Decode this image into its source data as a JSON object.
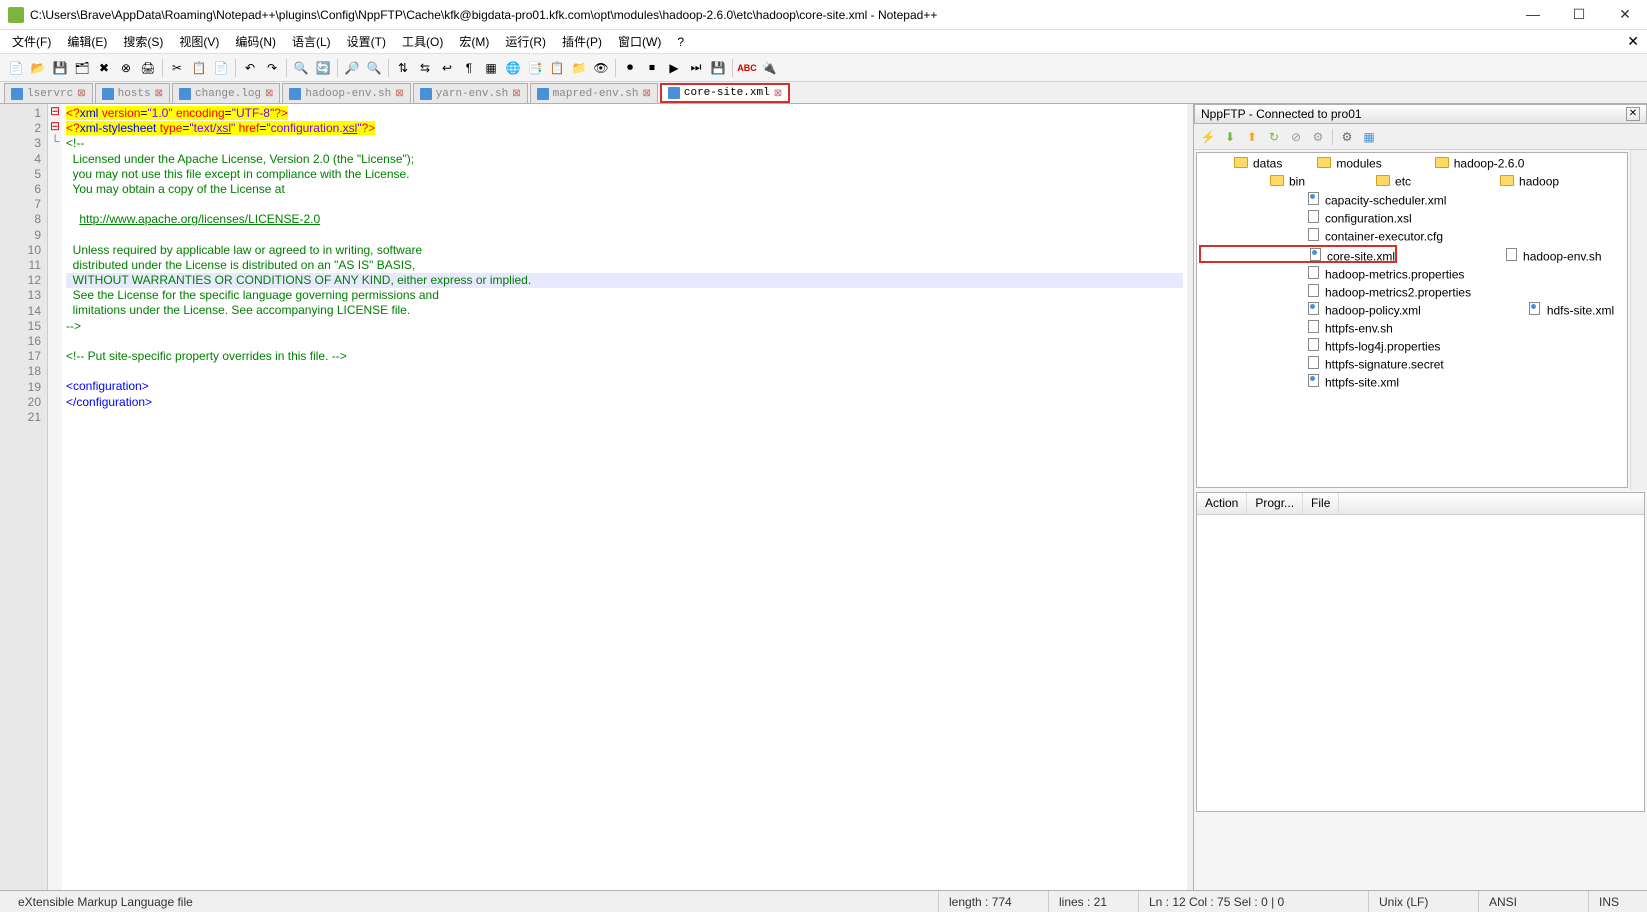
{
  "window": {
    "title": "C:\\Users\\Brave\\AppData\\Roaming\\Notepad++\\plugins\\Config\\NppFTP\\Cache\\kfk@bigdata-pro01.kfk.com\\opt\\modules\\hadoop-2.6.0\\etc\\hadoop\\core-site.xml - Notepad++"
  },
  "menu": {
    "items": [
      "文件(F)",
      "编辑(E)",
      "搜索(S)",
      "视图(V)",
      "编码(N)",
      "语言(L)",
      "设置(T)",
      "工具(O)",
      "宏(M)",
      "运行(R)",
      "插件(P)",
      "窗口(W)",
      "?"
    ]
  },
  "tabs": [
    {
      "label": "lservrc",
      "active": false
    },
    {
      "label": "hosts",
      "active": false
    },
    {
      "label": "change.log",
      "active": false
    },
    {
      "label": "hadoop-env.sh",
      "active": false
    },
    {
      "label": "yarn-env.sh",
      "active": false
    },
    {
      "label": "mapred-env.sh",
      "active": false
    },
    {
      "label": "core-site.xml",
      "active": true,
      "highlighted": true
    }
  ],
  "code": {
    "lines": [
      {
        "n": 1,
        "html": "<span class='hl-yellow'><span class='c-red'>&lt;?</span><span class='c-blue'>xml</span> <span class='c-red'>version</span>=<span class='c-purple'>\"1.0\"</span> <span class='c-red'>encoding</span>=<span class='c-purple'>\"UTF-8\"</span><span class='c-red'>?&gt;</span></span>"
      },
      {
        "n": 2,
        "html": "<span class='hl-yellow'><span class='c-red'>&lt;?</span><span class='c-blue'>xml-stylesheet</span> <span class='c-red'>type</span>=<span class='c-purple'>\"text/</span><span class='c-purple underline'>xsl</span><span class='c-purple'>\"</span> <span class='c-red'>href</span>=<span class='c-purple'>\"configuration.</span><span class='c-purple underline'>xsl</span><span class='c-purple'>\"</span><span class='c-red'>?&gt;</span></span>"
      },
      {
        "n": 3,
        "fold": "⊟",
        "html": "<span class='c-green'>&lt;!--</span>"
      },
      {
        "n": 4,
        "html": "<span class='c-green'>  Licensed under the Apache License, Version 2.0 (the \"License\");</span>"
      },
      {
        "n": 5,
        "html": "<span class='c-green'>  you may not use this file except in compliance with the License.</span>"
      },
      {
        "n": 6,
        "html": "<span class='c-green'>  You may obtain a copy of the License at</span>"
      },
      {
        "n": 7,
        "html": ""
      },
      {
        "n": 8,
        "html": "<span class='c-green'>    </span><span class='c-green underline'>http://www.apache.org/licenses/LICENSE-2.0</span>"
      },
      {
        "n": 9,
        "html": ""
      },
      {
        "n": 10,
        "html": "<span class='c-green'>  Unless required by applicable law or agreed to in writing, software</span>"
      },
      {
        "n": 11,
        "html": "<span class='c-green'>  distributed under the License is distributed on an \"AS IS\" BASIS,</span>"
      },
      {
        "n": 12,
        "cursor": true,
        "html": "<span class='c-green'>  WITHOUT WARRANTIES OR CONDITIONS OF ANY KIND, either express or implied.</span>"
      },
      {
        "n": 13,
        "html": "<span class='c-green'>  See the License for the specific language governing permissions and</span>"
      },
      {
        "n": 14,
        "html": "<span class='c-green'>  limitations under the License. See accompanying LICENSE file.</span>"
      },
      {
        "n": 15,
        "html": "<span class='c-green'>--&gt;</span>"
      },
      {
        "n": 16,
        "html": ""
      },
      {
        "n": 17,
        "html": "<span class='c-green'>&lt;!-- Put site-specific property overrides in this file. --&gt;</span>"
      },
      {
        "n": 18,
        "html": ""
      },
      {
        "n": 19,
        "fold": "⊟",
        "html": "<span class='c-blue'>&lt;configuration&gt;</span>"
      },
      {
        "n": 20,
        "fold": "└",
        "html": "<span class='c-blue'>&lt;/configuration&gt;</span>"
      },
      {
        "n": 21,
        "html": ""
      }
    ]
  },
  "nppftp": {
    "title": "NppFTP - Connected to pro01",
    "tree": [
      {
        "indent": 2,
        "type": "folder",
        "label": "datas"
      },
      {
        "indent": 2,
        "type": "folder",
        "label": "modules"
      },
      {
        "indent": 3,
        "type": "folder",
        "label": "hadoop-2.6.0"
      },
      {
        "indent": 4,
        "type": "folder",
        "label": "bin"
      },
      {
        "indent": 4,
        "type": "folder",
        "label": "etc"
      },
      {
        "indent": 5,
        "type": "folder",
        "label": "hadoop"
      },
      {
        "indent": 6,
        "type": "file-xml",
        "label": "capacity-scheduler.xml"
      },
      {
        "indent": 6,
        "type": "file-cfg",
        "label": "configuration.xsl"
      },
      {
        "indent": 6,
        "type": "file",
        "label": "container-executor.cfg"
      },
      {
        "indent": 6,
        "type": "file-xml",
        "label": "core-site.xml",
        "highlighted": true
      },
      {
        "indent": 6,
        "type": "file",
        "label": "hadoop-env.sh"
      },
      {
        "indent": 6,
        "type": "file",
        "label": "hadoop-metrics.properties"
      },
      {
        "indent": 6,
        "type": "file",
        "label": "hadoop-metrics2.properties"
      },
      {
        "indent": 6,
        "type": "file-xml",
        "label": "hadoop-policy.xml"
      },
      {
        "indent": 6,
        "type": "file-xml",
        "label": "hdfs-site.xml"
      },
      {
        "indent": 6,
        "type": "file",
        "label": "httpfs-env.sh"
      },
      {
        "indent": 6,
        "type": "file",
        "label": "httpfs-log4j.properties"
      },
      {
        "indent": 6,
        "type": "file",
        "label": "httpfs-signature.secret"
      },
      {
        "indent": 6,
        "type": "file-xml",
        "label": "httpfs-site.xml"
      }
    ],
    "grid_cols": [
      "Action",
      "Progr...",
      "File"
    ]
  },
  "status": {
    "lang": "eXtensible Markup Language file",
    "length": "length : 774",
    "lines": "lines : 21",
    "pos": "Ln : 12    Col : 75    Sel : 0 | 0",
    "eol": "Unix (LF)",
    "enc": "ANSI",
    "ins": "INS"
  }
}
